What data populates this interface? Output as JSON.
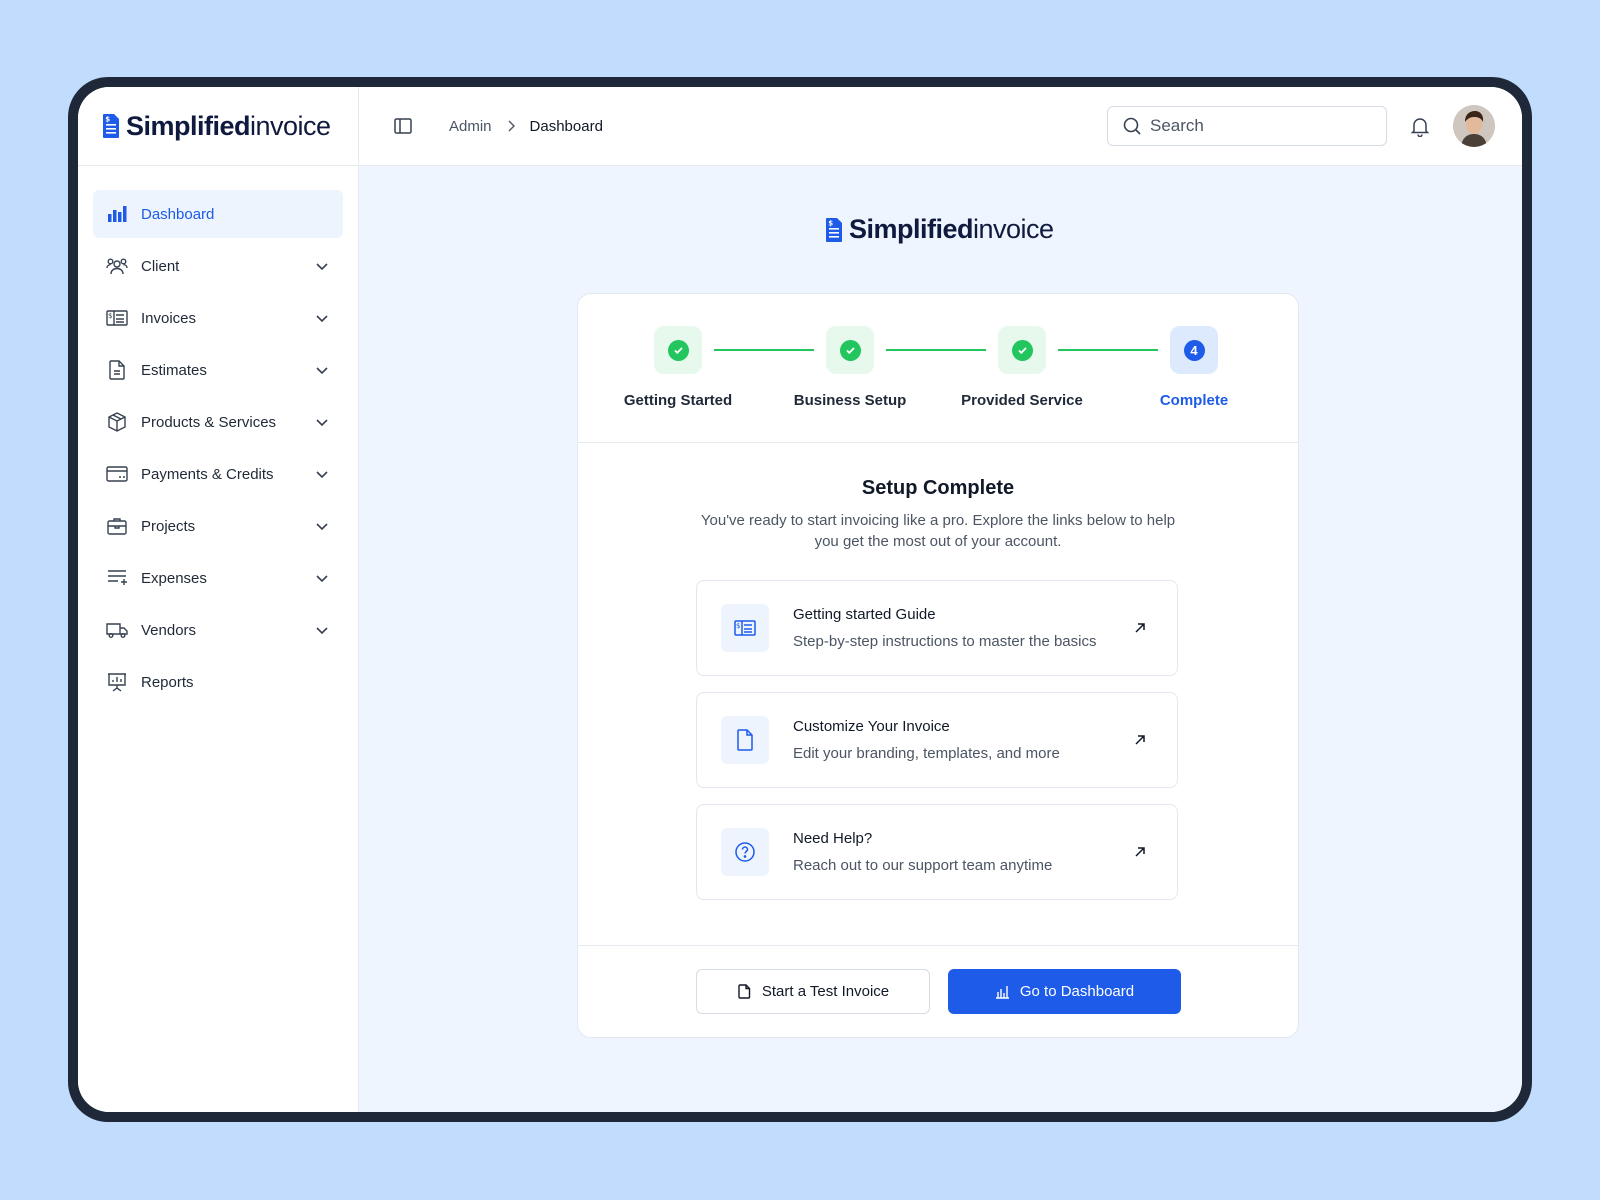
{
  "brand": {
    "name_bold": "Simplified",
    "name_regular": "invoice"
  },
  "colors": {
    "accent": "#1d5be8",
    "success": "#22c55e",
    "background": "#c2dcfd",
    "content_bg": "#eff5fe"
  },
  "sidebar": {
    "items": [
      {
        "label": "Dashboard",
        "icon": "bar-chart-icon",
        "active": true,
        "expandable": false
      },
      {
        "label": "Client",
        "icon": "users-icon",
        "expandable": true
      },
      {
        "label": "Invoices",
        "icon": "invoice-icon",
        "expandable": true
      },
      {
        "label": "Estimates",
        "icon": "file-text-icon",
        "expandable": true
      },
      {
        "label": "Products & Services",
        "icon": "box-icon",
        "expandable": true
      },
      {
        "label": "Payments & Credits",
        "icon": "credit-card-icon",
        "expandable": true
      },
      {
        "label": "Projects",
        "icon": "briefcase-icon",
        "expandable": true
      },
      {
        "label": "Expenses",
        "icon": "list-plus-icon",
        "expandable": true
      },
      {
        "label": "Vendors",
        "icon": "truck-icon",
        "expandable": true
      },
      {
        "label": "Reports",
        "icon": "presentation-chart-icon",
        "expandable": false
      }
    ]
  },
  "header": {
    "breadcrumb": [
      "Admin",
      "Dashboard"
    ],
    "search": {
      "placeholder": "Search",
      "value": ""
    }
  },
  "stepper": {
    "steps": [
      {
        "label": "Getting Started",
        "status": "done"
      },
      {
        "label": "Business Setup",
        "status": "done"
      },
      {
        "label": "Provided Service",
        "status": "done"
      },
      {
        "label": "Complete",
        "status": "current",
        "number": "4"
      }
    ]
  },
  "setup": {
    "title": "Setup Complete",
    "subtitle": "You've ready to start invoicing like a pro. Explore the links below to help you get the most out of your account.",
    "links": [
      {
        "title": "Getting started Guide",
        "description": "Step-by-step instructions to master the basics",
        "icon": "invoice-icon"
      },
      {
        "title": "Customize Your Invoice",
        "description": "Edit your branding, templates, and more",
        "icon": "document-icon"
      },
      {
        "title": "Need Help?",
        "description": "Reach out to our support team anytime",
        "icon": "help-circle-icon"
      }
    ]
  },
  "footer": {
    "secondary_button": "Start a Test Invoice",
    "primary_button": "Go to Dashboard"
  }
}
